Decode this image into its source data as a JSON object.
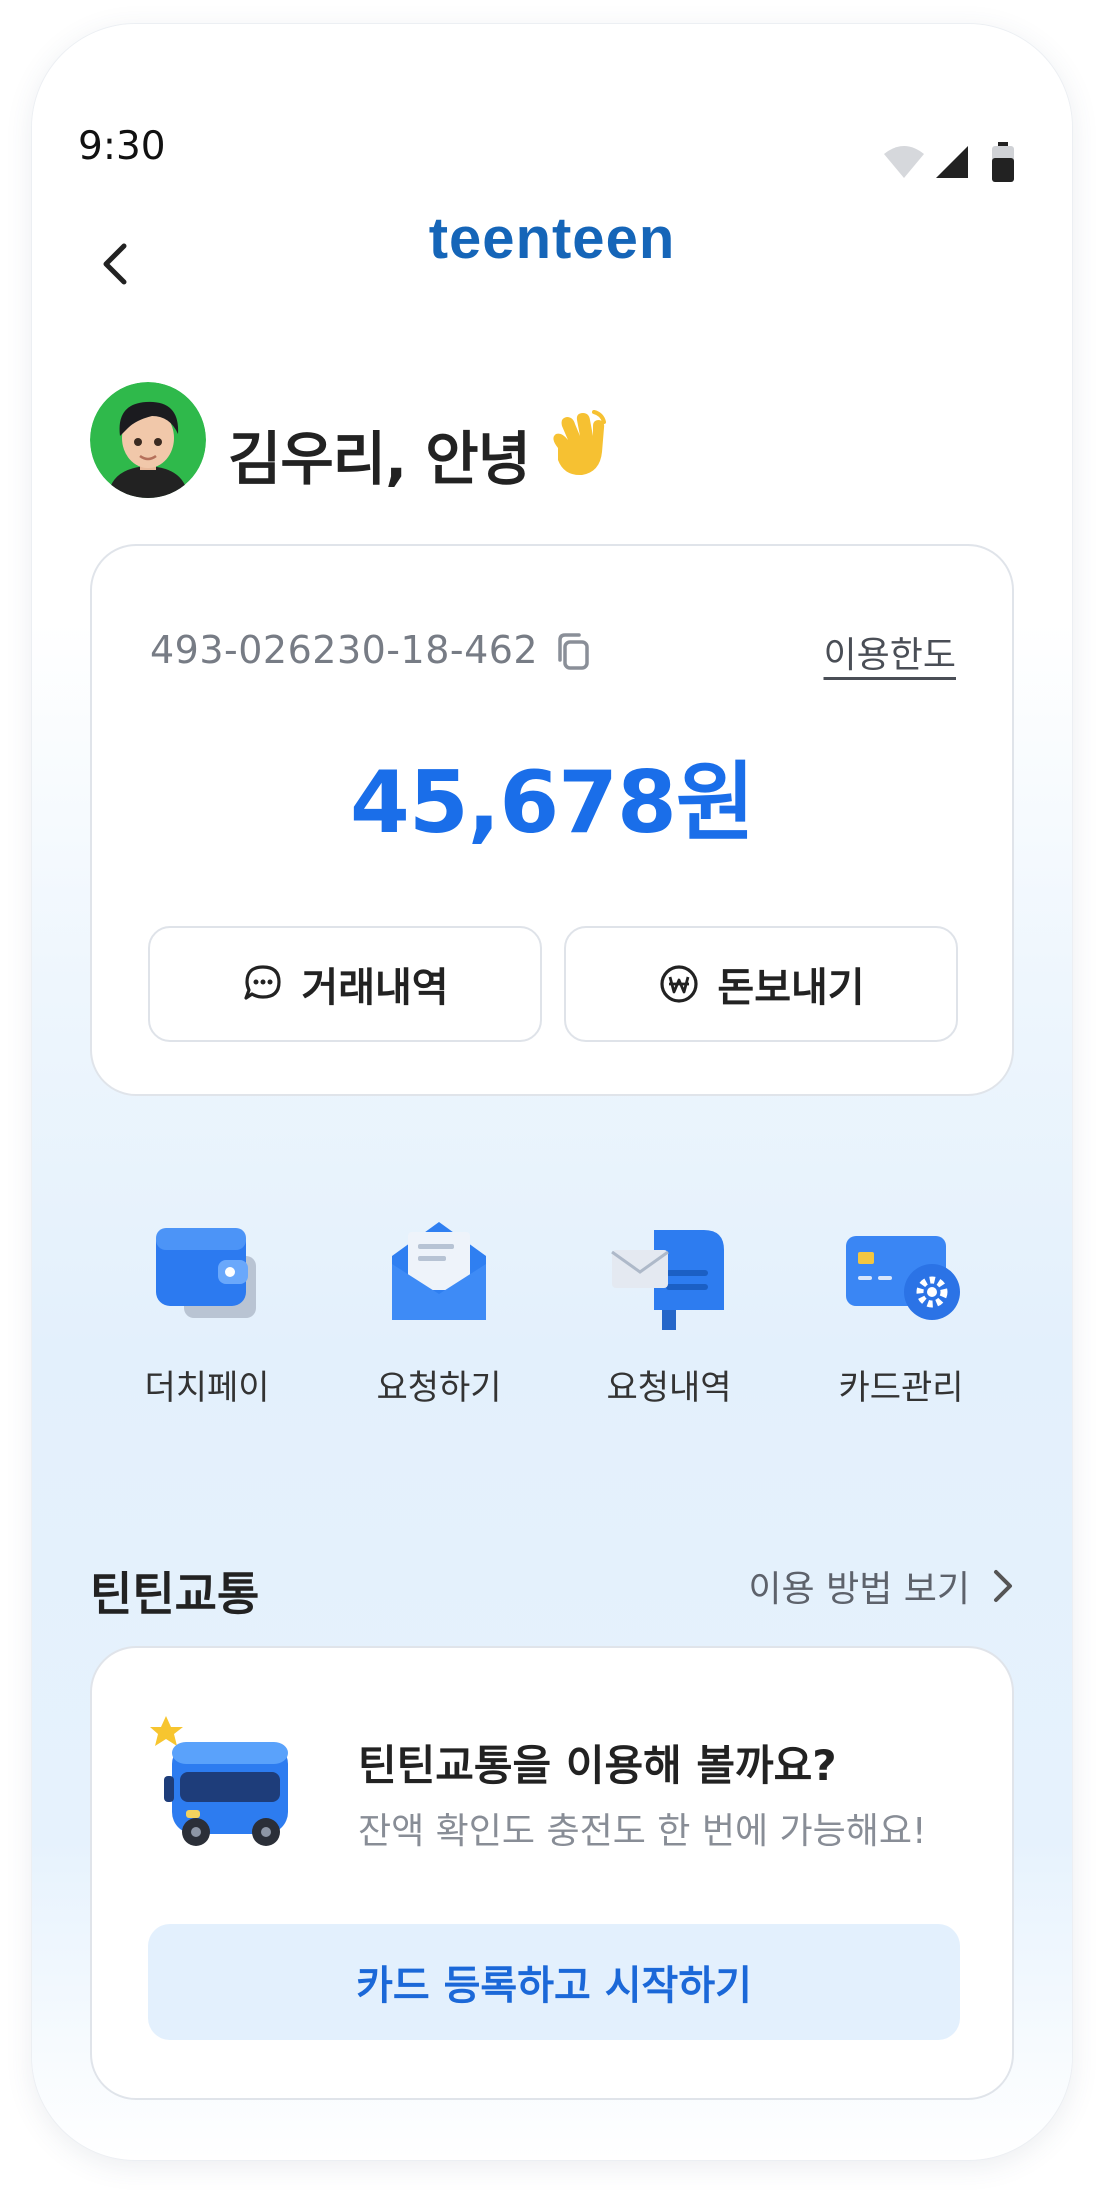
{
  "status_bar": {
    "time": "9:30",
    "icons": [
      "wifi-icon",
      "signal-icon",
      "battery-icon"
    ]
  },
  "header": {
    "logo_text": "teenteen",
    "back_icon": "chevron-left-icon"
  },
  "greeting": {
    "text": "김우리, 안녕",
    "emoji_icon": "waving-hand-icon"
  },
  "account": {
    "number": "493-026230-18-462",
    "limit_link": "이용한도",
    "balance": "45,678원",
    "buttons": {
      "history": "거래내역",
      "send": "돈보내기"
    }
  },
  "quick_menu": [
    {
      "label": "더치페이",
      "icon": "wallet-icon"
    },
    {
      "label": "요청하기",
      "icon": "open-envelope-icon"
    },
    {
      "label": "요청내역",
      "icon": "mailbox-icon"
    },
    {
      "label": "카드관리",
      "icon": "card-settings-icon"
    }
  ],
  "transit": {
    "section_title": "틴틴교통",
    "how_to_link": "이용 방법 보기",
    "card_title": "틴틴교통을 이용해 볼까요?",
    "card_subtitle": "잔액 확인도 충전도 한 번에 가능해요!",
    "cta": "카드 등록하고 시작하기"
  },
  "colors": {
    "brand_blue": "#1a6ee9",
    "logo_blue": "#1565b8",
    "cta_bg": "#e3f0fd"
  }
}
